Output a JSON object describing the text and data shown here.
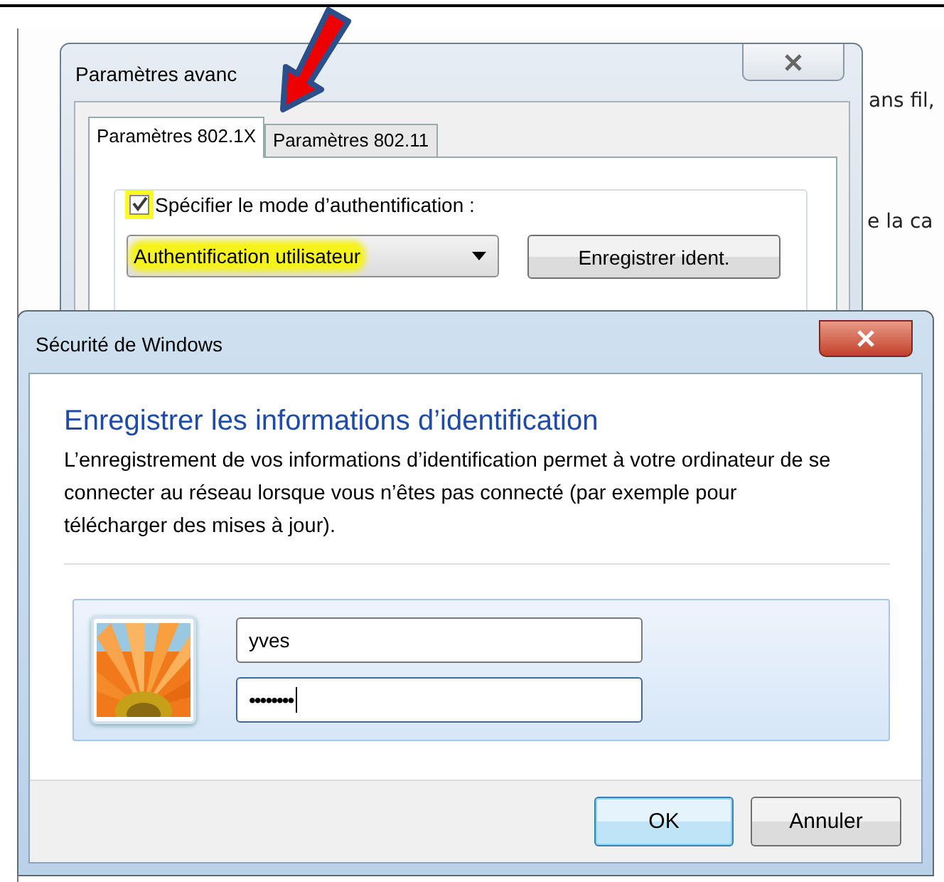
{
  "background_window": {
    "texts": [
      "ans fil,",
      "e la ca"
    ]
  },
  "back_dialog": {
    "title": "Paramètres avanc",
    "tabs": [
      {
        "label": "Paramètres 802.1X",
        "selected": true
      },
      {
        "label": "Paramètres 802.11",
        "selected": false
      }
    ],
    "auth_checkbox": {
      "label": "Spécifier le mode d’authentification :",
      "checked": true,
      "highlighted": true
    },
    "auth_mode": {
      "value": "Authentification utilisateur",
      "highlighted": true
    },
    "save_button": "Enregistrer ident."
  },
  "dialog": {
    "title": "Sécurité de Windows",
    "heading": "Enregistrer les informations d’identification",
    "description": "L’enregistrement de vos informations d’identification permet à votre ordinateur de se connecter au réseau lorsque vous n’êtes pas connecté (par exemple pour télécharger des mises à jour).",
    "username": {
      "value": "yves"
    },
    "password": {
      "value": "••••••••",
      "focused": true
    },
    "buttons": [
      {
        "label": "OK",
        "default": true
      },
      {
        "label": "Annuler",
        "default": false
      }
    ]
  }
}
